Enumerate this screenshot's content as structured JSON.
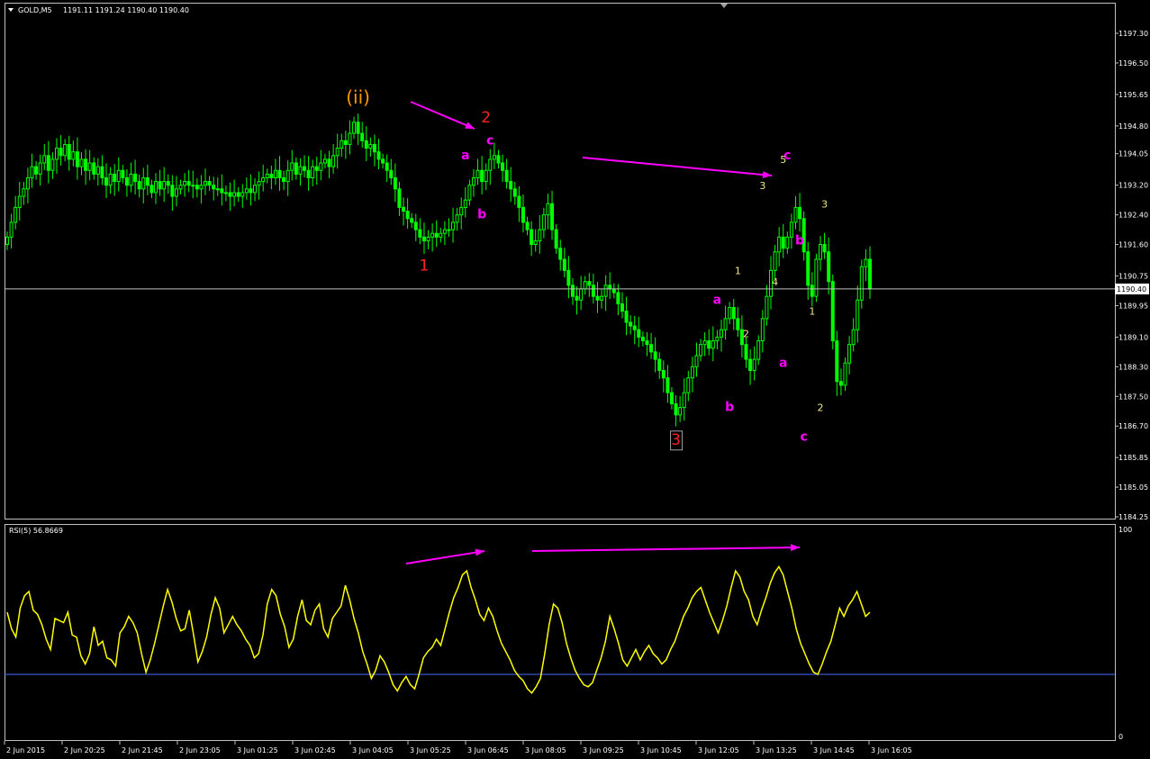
{
  "header": {
    "symbol": "GOLD,M5",
    "ohlc": "1191.11 1191.24 1190.40 1190.40"
  },
  "rsi_header": "RSI(5) 56.8669",
  "colors": {
    "background": "#000000",
    "candle": "#00ff00",
    "frame": "#c0c0c0",
    "rsi_line": "#ffff00",
    "rsi_level": "#4a6cff",
    "arrow": "#ff00ff",
    "label_red": "#ff2020",
    "label_orange": "#ff9900",
    "label_magenta": "#ff00ff",
    "label_yellow": "#f0e68c",
    "price_line": "#c0c0c0"
  },
  "price_axis": {
    "ticks": [
      "1197.30",
      "1196.50",
      "1195.65",
      "1194.80",
      "1194.05",
      "1193.20",
      "1192.40",
      "1191.60",
      "1190.75",
      "1189.95",
      "1189.10",
      "1188.30",
      "1187.50",
      "1186.70",
      "1185.85",
      "1185.05",
      "1184.25"
    ],
    "current": "1190.40"
  },
  "rsi_axis": {
    "ticks": [
      "100",
      "0"
    ],
    "level": 30
  },
  "time_axis": {
    "labels": [
      "2 Jun 2015",
      "2 Jun 20:25",
      "2 Jun 21:45",
      "2 Jun 23:05",
      "3 Jun 01:25",
      "3 Jun 02:45",
      "3 Jun 04:05",
      "3 Jun 05:25",
      "3 Jun 06:45",
      "3 Jun 08:05",
      "3 Jun 09:25",
      "3 Jun 10:45",
      "3 Jun 12:05",
      "3 Jun 13:25",
      "3 Jun 14:45",
      "3 Jun 16:05"
    ]
  },
  "chart_data": {
    "type": "line",
    "title": "GOLD,M5",
    "price_close": [
      1191.8,
      1192.2,
      1192.6,
      1192.9,
      1193.1,
      1193.4,
      1193.7,
      1193.5,
      1193.8,
      1194.0,
      1193.6,
      1193.9,
      1194.2,
      1194.0,
      1194.3,
      1193.9,
      1194.1,
      1193.7,
      1193.9,
      1193.6,
      1193.8,
      1193.5,
      1193.7,
      1193.4,
      1193.2,
      1193.5,
      1193.3,
      1193.6,
      1193.4,
      1193.2,
      1193.5,
      1193.3,
      1193.1,
      1193.4,
      1193.2,
      1193.0,
      1193.3,
      1193.1,
      1193.3,
      1193.2,
      1192.9,
      1193.1,
      1193.2,
      1193.3,
      1193.2,
      1193.2,
      1193.1,
      1193.2,
      1193.3,
      1193.2,
      1193.1,
      1193.1,
      1193.0,
      1193.0,
      1192.9,
      1193.0,
      1192.9,
      1193.0,
      1193.1,
      1193.0,
      1193.2,
      1193.3,
      1193.4,
      1193.5,
      1193.4,
      1193.6,
      1193.4,
      1193.3,
      1193.6,
      1193.8,
      1193.5,
      1193.7,
      1193.6,
      1193.4,
      1193.7,
      1193.6,
      1193.8,
      1193.9,
      1193.7,
      1194.0,
      1194.2,
      1194.4,
      1194.3,
      1194.6,
      1194.9,
      1194.6,
      1194.4,
      1194.2,
      1194.3,
      1194.1,
      1193.9,
      1193.8,
      1193.6,
      1193.4,
      1193.1,
      1192.6,
      1192.5,
      1192.3,
      1192.2,
      1192.0,
      1191.8,
      1191.7,
      1191.8,
      1191.9,
      1191.8,
      1191.9,
      1192.0,
      1192.0,
      1192.2,
      1192.4,
      1192.6,
      1192.8,
      1193.2,
      1193.4,
      1193.6,
      1193.3,
      1193.6,
      1193.9,
      1194.0,
      1193.8,
      1193.6,
      1193.3,
      1193.1,
      1192.9,
      1192.6,
      1192.2,
      1192.0,
      1191.6,
      1191.7,
      1192.0,
      1192.4,
      1192.7,
      1192.0,
      1191.5,
      1191.2,
      1190.9,
      1190.5,
      1190.2,
      1190.1,
      1190.4,
      1190.6,
      1190.5,
      1190.2,
      1190.1,
      1190.2,
      1190.5,
      1190.4,
      1190.3,
      1190.0,
      1189.8,
      1189.5,
      1189.4,
      1189.3,
      1189.1,
      1189.0,
      1188.9,
      1188.7,
      1188.5,
      1188.2,
      1188.0,
      1187.6,
      1187.3,
      1187.0,
      1187.2,
      1187.6,
      1188.0,
      1188.3,
      1188.6,
      1188.9,
      1189.0,
      1188.8,
      1189.0,
      1189.1,
      1189.3,
      1189.6,
      1189.9,
      1189.6,
      1189.3,
      1188.9,
      1188.5,
      1188.2,
      1188.5,
      1189.0,
      1189.6,
      1190.2,
      1190.9,
      1191.4,
      1191.8,
      1191.5,
      1191.8,
      1192.2,
      1192.6,
      1192.3,
      1191.4,
      1190.5,
      1190.2,
      1191.2,
      1191.6,
      1191.4,
      1190.6,
      1189.0,
      1187.9,
      1187.8,
      1188.4,
      1188.9,
      1189.3,
      1190.1,
      1191.0,
      1191.2,
      1190.4
    ],
    "rsi": [
      60,
      52,
      48,
      62,
      68,
      70,
      61,
      59,
      54,
      47,
      42,
      57,
      56,
      55,
      60,
      49,
      48,
      39,
      35,
      40,
      53,
      44,
      46,
      38,
      37,
      34,
      50,
      53,
      58,
      55,
      50,
      40,
      31,
      37,
      45,
      54,
      63,
      71,
      65,
      57,
      51,
      52,
      61,
      49,
      36,
      41,
      48,
      59,
      67,
      62,
      50,
      54,
      58,
      54,
      51,
      47,
      44,
      38,
      40,
      49,
      64,
      71,
      68,
      59,
      53,
      43,
      47,
      58,
      66,
      56,
      54,
      61,
      64,
      52,
      48,
      57,
      60,
      63,
      73,
      66,
      57,
      50,
      41,
      35,
      28,
      32,
      39,
      36,
      31,
      25,
      22,
      26,
      29,
      25,
      23,
      30,
      38,
      41,
      43,
      47,
      44,
      52,
      60,
      67,
      72,
      78,
      80,
      72,
      66,
      59,
      56,
      62,
      58,
      51,
      45,
      41,
      37,
      32,
      29,
      27,
      23,
      21,
      24,
      28,
      40,
      54,
      64,
      62,
      55,
      45,
      38,
      32,
      28,
      25,
      24,
      26,
      32,
      38,
      46,
      58,
      52,
      45,
      37,
      34,
      38,
      42,
      37,
      41,
      44,
      40,
      38,
      35,
      37,
      42,
      46,
      52,
      58,
      62,
      67,
      70,
      72,
      66,
      60,
      55,
      50,
      56,
      63,
      72,
      80,
      77,
      70,
      66,
      58,
      54,
      61,
      67,
      74,
      79,
      82,
      78,
      70,
      62,
      52,
      45,
      40,
      35,
      31,
      30,
      35,
      41,
      46,
      54,
      62,
      58,
      63,
      66,
      70,
      64,
      58,
      60
    ],
    "xlabel": "",
    "ylabel": "",
    "ylim": [
      1184.25,
      1197.7
    ],
    "rsi_ylim": [
      0,
      100
    ],
    "rsi_level": 30,
    "annotations": [
      {
        "text": "(ii)",
        "bar": 85,
        "price": 1195.4,
        "color": "orange"
      },
      {
        "text": "2",
        "bar": 116,
        "price": 1194.9,
        "color": "red"
      },
      {
        "text": "1",
        "bar": 101,
        "price": 1190.9,
        "color": "red"
      },
      {
        "text": "3",
        "bar": 162,
        "price": 1186.2,
        "color": "red"
      },
      {
        "text": "c",
        "bar": 117,
        "price": 1194.3,
        "color": "magenta"
      },
      {
        "text": "a",
        "bar": 111,
        "price": 1193.9,
        "color": "magenta"
      },
      {
        "text": "b",
        "bar": 115,
        "price": 1192.3,
        "color": "magenta"
      },
      {
        "text": "a",
        "bar": 172,
        "price": 1190.0,
        "color": "magenta"
      },
      {
        "text": "b",
        "bar": 175,
        "price": 1187.1,
        "color": "magenta"
      },
      {
        "text": "c",
        "bar": 189,
        "price": 1193.9,
        "color": "magenta"
      },
      {
        "text": "b",
        "bar": 192,
        "price": 1191.6,
        "color": "magenta"
      },
      {
        "text": "a",
        "bar": 188,
        "price": 1188.3,
        "color": "magenta"
      },
      {
        "text": "c",
        "bar": 193,
        "price": 1186.3,
        "color": "magenta"
      },
      {
        "text": "1",
        "bar": 177,
        "price": 1190.8,
        "color": "yellow"
      },
      {
        "text": "2",
        "bar": 179,
        "price": 1189.1,
        "color": "yellow"
      },
      {
        "text": "3",
        "bar": 183,
        "price": 1193.1,
        "color": "yellow"
      },
      {
        "text": "4",
        "bar": 186,
        "price": 1190.5,
        "color": "yellow"
      },
      {
        "text": "5",
        "bar": 188,
        "price": 1193.8,
        "color": "yellow"
      },
      {
        "text": "1",
        "bar": 195,
        "price": 1189.7,
        "color": "yellow"
      },
      {
        "text": "2",
        "bar": 197,
        "price": 1187.1,
        "color": "yellow"
      },
      {
        "text": "3",
        "bar": 198,
        "price": 1192.6,
        "color": "yellow"
      }
    ]
  }
}
